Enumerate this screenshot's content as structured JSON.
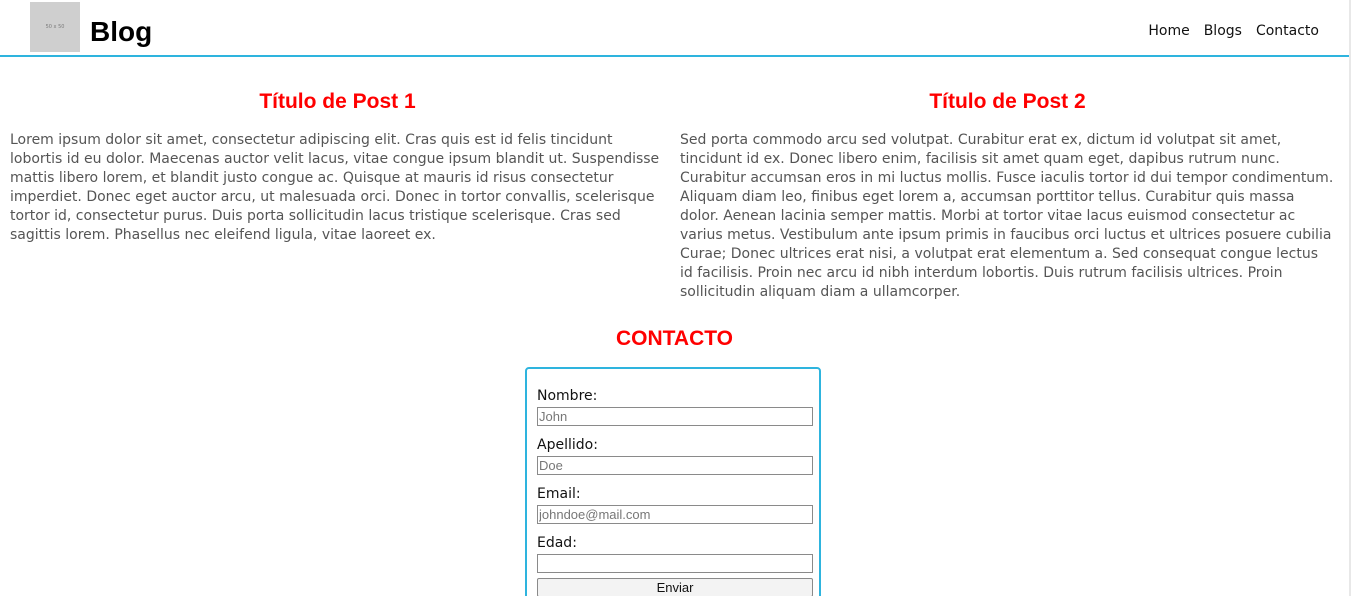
{
  "header": {
    "logo_text": "50 x 50",
    "title": "Blog",
    "nav": [
      {
        "label": "Home"
      },
      {
        "label": "Blogs"
      },
      {
        "label": "Contacto"
      }
    ]
  },
  "posts": [
    {
      "title": "Título de Post 1",
      "body": "Lorem ipsum dolor sit amet, consectetur adipiscing elit. Cras quis est id felis tincidunt lobortis id eu dolor. Maecenas auctor velit lacus, vitae congue ipsum blandit ut. Suspendisse mattis libero lorem, et blandit justo congue ac. Quisque at mauris id risus consectetur imperdiet. Donec eget auctor arcu, ut malesuada orci. Donec in tortor convallis, scelerisque tortor id, consectetur purus. Duis porta sollicitudin lacus tristique scelerisque. Cras sed sagittis lorem. Phasellus nec eleifend ligula, vitae laoreet ex."
    },
    {
      "title": "Título de Post 2",
      "body": "Sed porta commodo arcu sed volutpat. Curabitur erat ex, dictum id volutpat sit amet, tincidunt id ex. Donec libero enim, facilisis sit amet quam eget, dapibus rutrum nunc. Curabitur accumsan eros in mi luctus mollis. Fusce iaculis tortor id dui tempor condimentum. Aliquam diam leo, finibus eget lorem a, accumsan porttitor tellus. Curabitur quis massa dolor. Aenean lacinia semper mattis. Morbi at tortor vitae lacus euismod consectetur ac varius metus. Vestibulum ante ipsum primis in faucibus orci luctus et ultrices posuere cubilia Curae; Donec ultrices erat nisi, a volutpat erat elementum a. Sed consequat congue lectus id facilisis. Proin nec arcu id nibh interdum lobortis. Duis rutrum facilisis ultrices. Proin sollicitudin aliquam diam a ullamcorper."
    }
  ],
  "contact": {
    "title": "CONTACTO",
    "fields": [
      {
        "label": "Nombre:",
        "placeholder": "John",
        "value": ""
      },
      {
        "label": "Apellido:",
        "placeholder": "Doe",
        "value": ""
      },
      {
        "label": "Email:",
        "placeholder": "johndoe@mail.com",
        "value": ""
      },
      {
        "label": "Edad:",
        "placeholder": "",
        "value": ""
      }
    ],
    "submit_label": "Enviar"
  },
  "colors": {
    "accent": "#2eb4de",
    "heading_red": "#ff0000",
    "body_text": "#555555"
  }
}
